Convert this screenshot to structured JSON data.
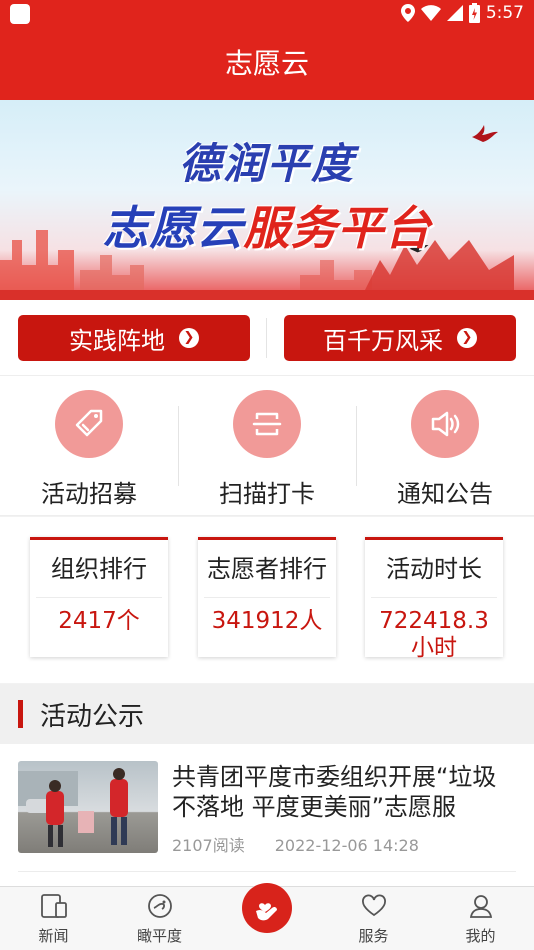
{
  "status_bar": {
    "time": "5:57"
  },
  "app_title": "志愿云",
  "banner": {
    "line1": "德润平度",
    "line2_blue": "志愿云",
    "line2_red": "服务平台"
  },
  "action_buttons": [
    {
      "label": "实践阵地",
      "icon": "chevron-right-circle-icon"
    },
    {
      "label": "百千万风采",
      "icon": "chevron-right-circle-icon"
    }
  ],
  "quick_actions": [
    {
      "label": "活动招募",
      "icon": "tag-icon"
    },
    {
      "label": "扫描打卡",
      "icon": "scan-icon"
    },
    {
      "label": "通知公告",
      "icon": "speaker-icon"
    }
  ],
  "stats": [
    {
      "title": "组织排行",
      "value": "2417个"
    },
    {
      "title": "志愿者排行",
      "value": "341912人"
    },
    {
      "title": "活动时长",
      "value": "722418.3小时"
    }
  ],
  "section": {
    "title": "活动公示"
  },
  "news_items": [
    {
      "title": "共青团平度市委组织开展“垃圾不落地 平度更美丽”志愿服",
      "reads": "2107阅读",
      "date": "2022-12-06 14:28"
    }
  ],
  "tab_bar": [
    {
      "label": "新闻",
      "icon": "tablet-icon"
    },
    {
      "label": "瞰平度",
      "icon": "compass-icon"
    },
    {
      "label": "",
      "icon": "heart-hand-icon"
    },
    {
      "label": "服务",
      "icon": "heart-outline-icon"
    },
    {
      "label": "我的",
      "icon": "person-icon"
    }
  ],
  "colors": {
    "primary": "#e0241c",
    "button": "#c8160f",
    "icon_circle": "#f19a98"
  }
}
